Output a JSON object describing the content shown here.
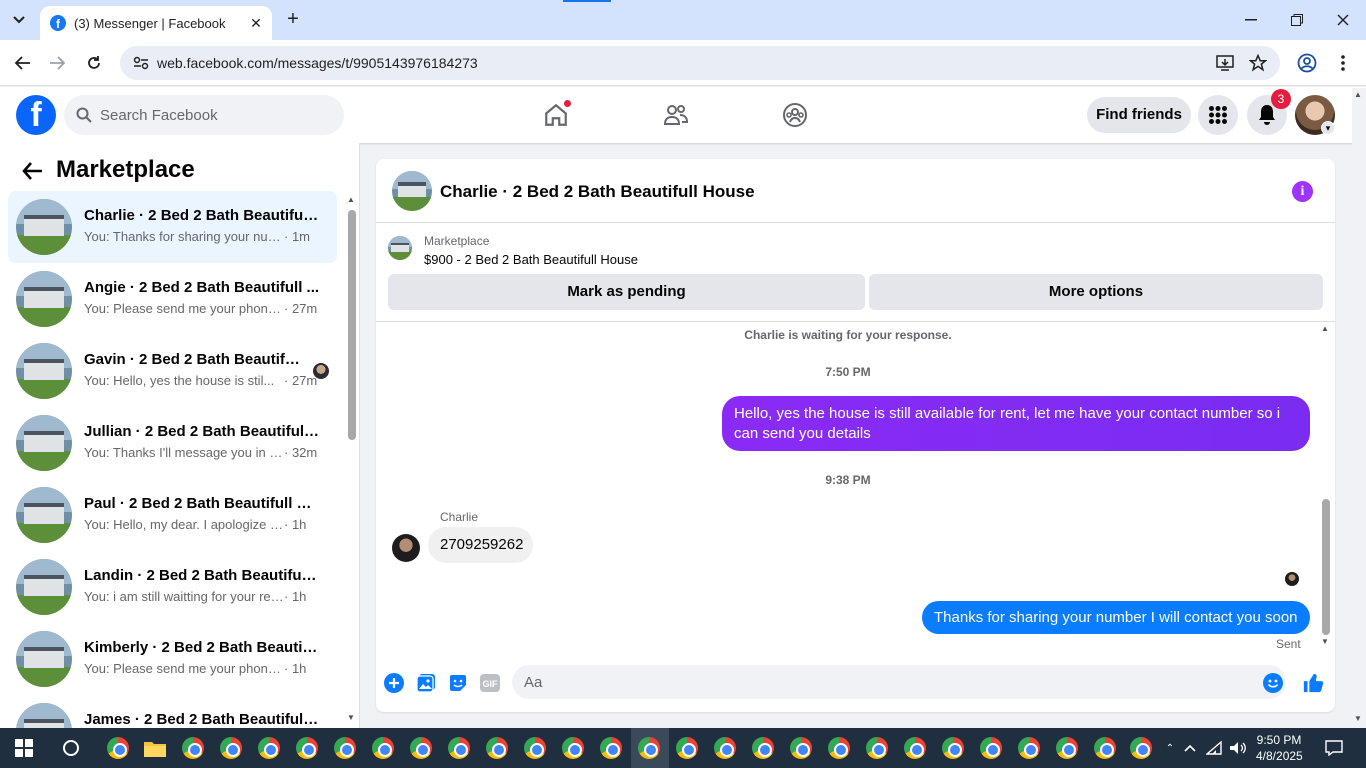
{
  "browser": {
    "tab_title": "(3) Messenger | Facebook",
    "url": "web.facebook.com/messages/t/9905143976184273"
  },
  "header": {
    "search_placeholder": "Search Facebook",
    "find_friends_label": "Find friends",
    "notification_count": "3"
  },
  "sidebar": {
    "title": "Marketplace",
    "conversations": [
      {
        "name": "Charlie · 2 Bed 2 Bath Beautifull ...",
        "preview": "You: Thanks for sharing your numb...",
        "time": "· 1m",
        "active": true
      },
      {
        "name": "Angie · 2 Bed 2 Bath Beautifull ...",
        "preview": "You: Please send me your phone ...",
        "time": "· 27m"
      },
      {
        "name": "Gavin · 2 Bed 2 Bath Beautifull...",
        "preview": "You: Hello, yes the house is stil...",
        "time": "· 27m"
      },
      {
        "name": "Jullian · 2 Bed 2 Bath Beautifull ...",
        "preview": "You: Thanks I'll message you in a ...",
        "time": "· 32m"
      },
      {
        "name": "Paul · 2 Bed 2 Bath Beautifull Ho...",
        "preview": "You: Hello, my dear. I apologize for ...",
        "time": "· 1h"
      },
      {
        "name": "Landin · 2 Bed 2 Bath Beautifull ...",
        "preview": "You: i am still waitting for your resp...",
        "time": "· 1h"
      },
      {
        "name": "Kimberly · 2 Bed 2 Bath Beautifu...",
        "preview": "You: Please send me your phone n...",
        "time": "· 1h"
      },
      {
        "name": "James · 2 Bed 2 Bath Beautifull ...",
        "preview": "",
        "time": ""
      }
    ]
  },
  "chat": {
    "title": "Charlie · 2 Bed 2 Bath Beautifull House",
    "listing_source": "Marketplace",
    "listing_price_title": "$900 - 2 Bed 2 Bath Beautifull House",
    "mark_pending_label": "Mark as pending",
    "more_options_label": "More options",
    "waiting_text": "Charlie is waiting for your response.",
    "timestamp_1": "7:50 PM",
    "message_out_1": "Hello, yes the house is still available for rent, let me have your contact number so i can send you  details",
    "timestamp_2": "9:38 PM",
    "sender_name": "Charlie",
    "message_in_1": "2709259262",
    "message_out_2": "Thanks for sharing your number I will contact you soon",
    "sent_status": "Sent",
    "composer_placeholder": "Aa"
  },
  "taskbar": {
    "time": "9:50 PM",
    "date": "4/8/2025"
  },
  "colors": {
    "facebook_blue": "#0866ff",
    "outgoing_purple": "#8a2bf5",
    "outgoing_blue": "#0a7cff",
    "badge_red": "#e41e3f"
  }
}
